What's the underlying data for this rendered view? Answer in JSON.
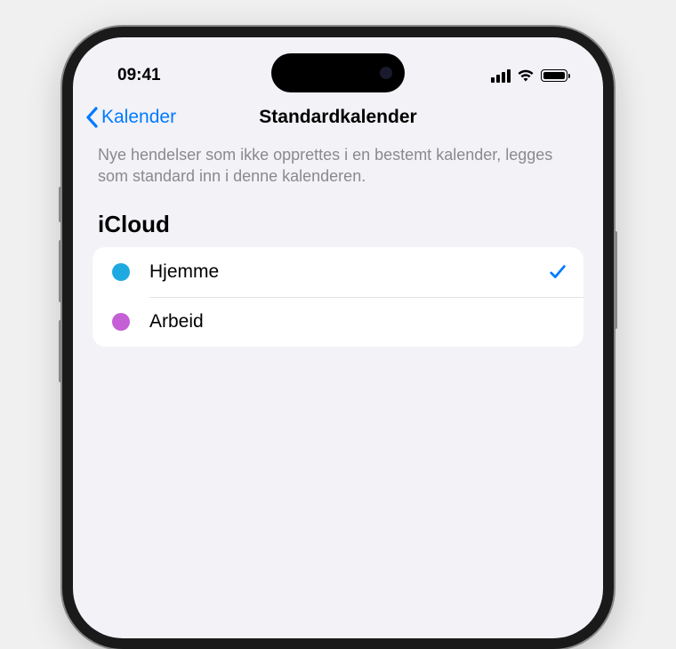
{
  "status": {
    "time": "09:41"
  },
  "nav": {
    "back_label": "Kalender",
    "title": "Standardkalender"
  },
  "description": "Nye hendelser som ikke opprettes i en bestemt kalender, legges som standard inn i denne kalenderen.",
  "section": {
    "header": "iCloud",
    "items": [
      {
        "label": "Hjemme",
        "color": "#1fa9e1",
        "selected": true
      },
      {
        "label": "Arbeid",
        "color": "#c45fd6",
        "selected": false
      }
    ]
  }
}
